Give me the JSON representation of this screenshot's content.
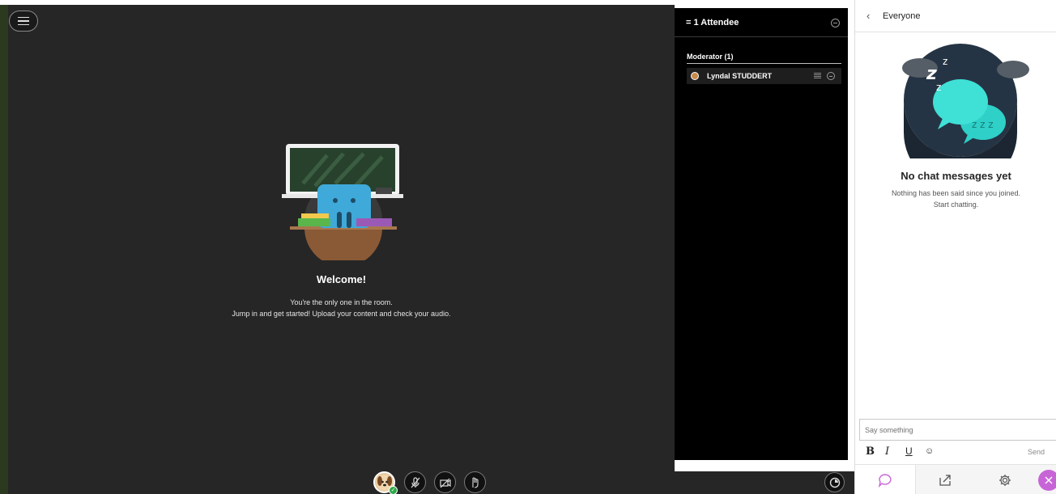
{
  "stage": {
    "welcome_title": "Welcome!",
    "welcome_line1": "You're the only one in the room.",
    "welcome_line2": "Jump in and get started! Upload your content and check your audio."
  },
  "attendees": {
    "title": "= 1 Attendee",
    "moderator_heading": "Moderator (1)",
    "list": [
      {
        "name": "Lyndal STUDDERT"
      }
    ]
  },
  "chat": {
    "title": "Everyone",
    "empty_title": "No chat messages yet",
    "empty_line1": "Nothing has been said since you joined.",
    "empty_line2": "Start chatting.",
    "input_placeholder": "Say something",
    "send_label": "Send",
    "format_buttons": [
      "B",
      "I",
      "U",
      "☺"
    ]
  },
  "controls": {
    "icons": [
      "menu-icon",
      "microphone-off-icon",
      "camera-off-icon",
      "raise-hand-icon",
      "network-status-icon"
    ]
  },
  "colors": {
    "stage_bg": "#262626",
    "attendee_bg": "#000000",
    "accent": "#c765d6",
    "status_green": "#2ea84a"
  }
}
